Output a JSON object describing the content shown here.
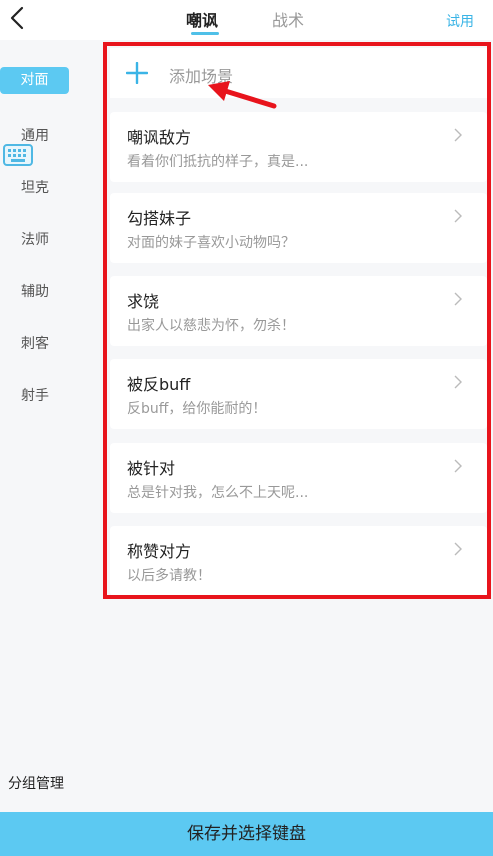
{
  "header": {
    "tabs": [
      {
        "label": "嘲讽",
        "active": true
      },
      {
        "label": "战术",
        "active": false
      }
    ],
    "trial_label": "试用"
  },
  "sidebar": {
    "items": [
      {
        "label": "对面",
        "active": true
      },
      {
        "label": "通用"
      },
      {
        "label": "坦克"
      },
      {
        "label": "法师"
      },
      {
        "label": "辅助"
      },
      {
        "label": "刺客"
      },
      {
        "label": "射手"
      }
    ],
    "group_manage_label": "分组管理"
  },
  "main": {
    "add_scene_label": "添加场景",
    "cards": [
      {
        "title": "嘲讽敌方",
        "subtitle": "看着你们抵抗的样子，真是..."
      },
      {
        "title": "勾搭妹子",
        "subtitle": "对面的妹子喜欢小动物吗？"
      },
      {
        "title": "求饶",
        "subtitle": "出家人以慈悲为怀，勿杀！"
      },
      {
        "title": "被反buff",
        "subtitle": "反buff，给你能耐的！"
      },
      {
        "title": "被针对",
        "subtitle": "总是针对我，怎么不上天呢..."
      },
      {
        "title": "称赞对方",
        "subtitle": "以后多请教！"
      }
    ]
  },
  "footer": {
    "save_label": "保存并选择键盘"
  },
  "colors": {
    "accent": "#5cc9f2",
    "annotation": "#e8141c"
  }
}
